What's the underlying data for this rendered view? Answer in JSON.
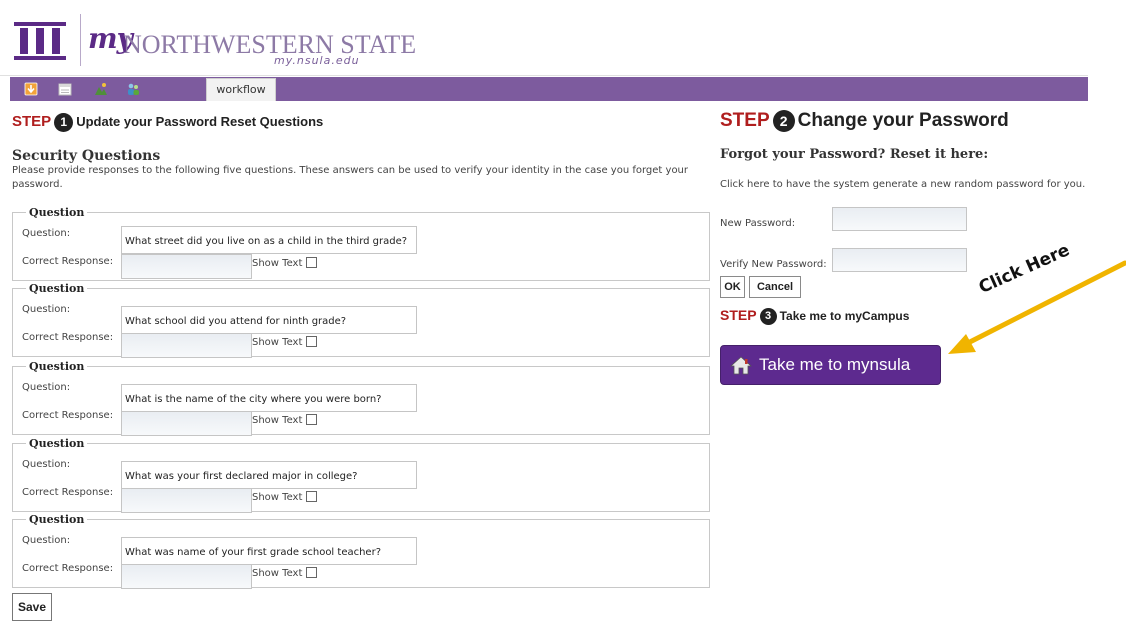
{
  "header": {
    "logo_my": "my",
    "logo_name": "NORTHWESTERN STATE",
    "logo_url": "my.nsula.edu"
  },
  "toolbar": {
    "icons": [
      "download-icon",
      "calendar-icon",
      "mountain-icon",
      "users-icon"
    ],
    "tab_label": "workflow"
  },
  "step1": {
    "word": "STEP",
    "number": "1",
    "title": "Update your Password Reset Questions"
  },
  "security": {
    "title": "Security Questions",
    "description": "Please provide responses to the following five questions. These answers can be used to verify your identity in the case you forget your password.",
    "legend": "Question",
    "question_label": "Question:",
    "response_label": "Correct Response:",
    "show_text_label": "Show Text",
    "questions": [
      {
        "text": "What street did you live on as a child in the third grade?",
        "response": ""
      },
      {
        "text": "What school did you attend for ninth grade?",
        "response": ""
      },
      {
        "text": "What is the name of the city where you were born?",
        "response": ""
      },
      {
        "text": "What was your first declared major in college?",
        "response": ""
      },
      {
        "text": "What was name of your first grade school teacher?",
        "response": ""
      }
    ],
    "save_label": "Save"
  },
  "step2": {
    "word": "STEP",
    "number": "2",
    "title": "Change your Password",
    "forgot_title": "Forgot your Password? Reset it here:",
    "generate_note": "Click here to have the system generate a new random password for you.",
    "new_password_label": "New Password:",
    "verify_password_label": "Verify New Password:",
    "ok_label": "OK",
    "cancel_label": "Cancel"
  },
  "step3": {
    "word": "STEP",
    "number": "3",
    "title": "Take me to myCampus",
    "button_label": "Take me to mynsula"
  },
  "annotation": {
    "text": "Click Here",
    "arrow_color": "#f0b400"
  },
  "colors": {
    "brand_purple": "#7d5b9e",
    "button_purple": "#5d2a8f",
    "step_red": "#b01e1e"
  }
}
